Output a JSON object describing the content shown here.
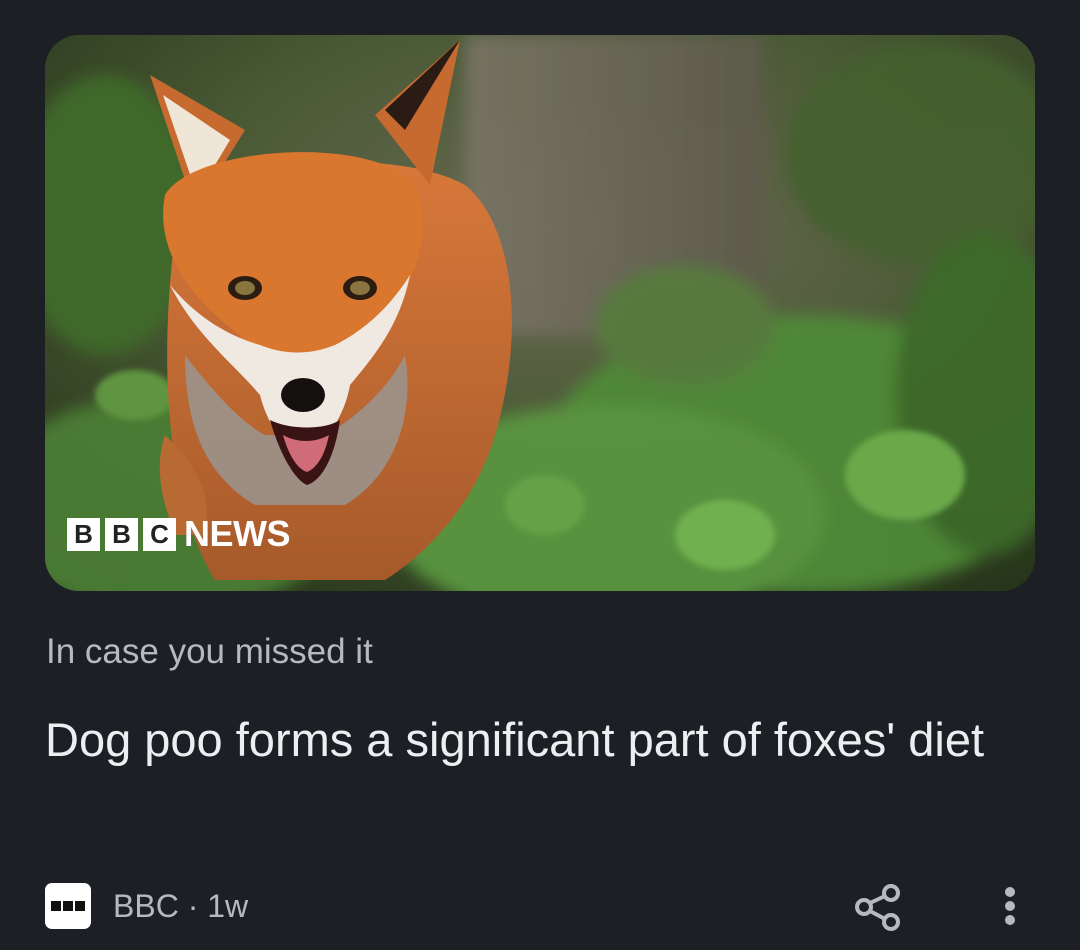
{
  "card": {
    "image": {
      "alt_subject": "fox-photo",
      "watermark": {
        "letters": [
          "B",
          "B",
          "C"
        ],
        "word": "NEWS"
      }
    },
    "kicker": "In case you missed it",
    "headline": "Dog poo forms a significant part of foxes' diet",
    "source": {
      "name": "BBC",
      "separator": " · ",
      "age": "1w",
      "logo_icon": "bbc-logo-icon"
    },
    "actions": {
      "share_icon": "share-icon",
      "more_icon": "more-vert-icon"
    }
  },
  "colors": {
    "background": "#1c1f24",
    "headline_text": "#eceff1",
    "secondary_text": "#b6b9be"
  }
}
